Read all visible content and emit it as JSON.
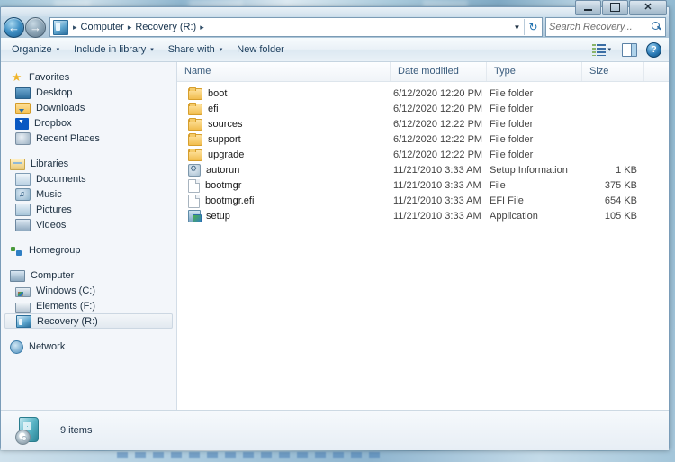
{
  "window": {
    "controls": {
      "minimize_label": "Minimize",
      "maximize_label": "Maximize",
      "close_label": "Close"
    }
  },
  "address_bar": {
    "back_label": "←",
    "forward_label": "→",
    "breadcrumbs": [
      "Computer",
      "Recovery (R:)"
    ],
    "separator": "▸",
    "dropdown_label": "▼",
    "refresh_label": "↻",
    "drive_icon": "recovery-drive-icon"
  },
  "search": {
    "placeholder": "Search Recovery...",
    "value": "Search Recovery...",
    "icon": "search-icon"
  },
  "toolbar": {
    "items": [
      {
        "label": "Organize",
        "has_caret": true
      },
      {
        "label": "Include in library",
        "has_caret": true
      },
      {
        "label": "Share with",
        "has_caret": true
      },
      {
        "label": "New folder",
        "has_caret": false
      }
    ],
    "caret": "▾",
    "views_icon": "view-options-icon",
    "preview_icon": "preview-pane-icon",
    "help_icon": "help-icon",
    "help_glyph": "?"
  },
  "sidebar": {
    "groups": [
      {
        "root": {
          "label": "Favorites",
          "icon": "star-icon"
        },
        "items": [
          {
            "label": "Desktop",
            "icon": "desktop-icon"
          },
          {
            "label": "Downloads",
            "icon": "downloads-folder-icon"
          },
          {
            "label": "Dropbox",
            "icon": "dropbox-icon"
          },
          {
            "label": "Recent Places",
            "icon": "recent-places-icon"
          }
        ]
      },
      {
        "root": {
          "label": "Libraries",
          "icon": "libraries-icon"
        },
        "items": [
          {
            "label": "Documents",
            "icon": "documents-icon"
          },
          {
            "label": "Music",
            "icon": "music-icon"
          },
          {
            "label": "Pictures",
            "icon": "pictures-icon"
          },
          {
            "label": "Videos",
            "icon": "videos-icon"
          }
        ]
      },
      {
        "root": {
          "label": "Homegroup",
          "icon": "homegroup-icon"
        },
        "items": []
      },
      {
        "root": {
          "label": "Computer",
          "icon": "computer-icon"
        },
        "items": [
          {
            "label": "Windows (C:)",
            "icon": "windows-drive-icon",
            "selected": false
          },
          {
            "label": "Elements (F:)",
            "icon": "usb-drive-icon",
            "selected": false
          },
          {
            "label": "Recovery (R:)",
            "icon": "recovery-drive-icon",
            "selected": true
          }
        ]
      },
      {
        "root": {
          "label": "Network",
          "icon": "network-icon"
        },
        "items": []
      }
    ]
  },
  "file_list": {
    "columns": [
      {
        "key": "name",
        "label": "Name"
      },
      {
        "key": "date",
        "label": "Date modified"
      },
      {
        "key": "type",
        "label": "Type"
      },
      {
        "key": "size",
        "label": "Size"
      }
    ],
    "rows": [
      {
        "name": "boot",
        "date": "6/12/2020 12:20 PM",
        "type": "File folder",
        "size": "",
        "icon": "folder-icon"
      },
      {
        "name": "efi",
        "date": "6/12/2020 12:20 PM",
        "type": "File folder",
        "size": "",
        "icon": "folder-icon"
      },
      {
        "name": "sources",
        "date": "6/12/2020 12:22 PM",
        "type": "File folder",
        "size": "",
        "icon": "folder-icon"
      },
      {
        "name": "support",
        "date": "6/12/2020 12:22 PM",
        "type": "File folder",
        "size": "",
        "icon": "folder-icon"
      },
      {
        "name": "upgrade",
        "date": "6/12/2020 12:22 PM",
        "type": "File folder",
        "size": "",
        "icon": "folder-icon"
      },
      {
        "name": "autorun",
        "date": "11/21/2010 3:33 AM",
        "type": "Setup Information",
        "size": "1 KB",
        "icon": "setup-information-icon"
      },
      {
        "name": "bootmgr",
        "date": "11/21/2010 3:33 AM",
        "type": "File",
        "size": "375 KB",
        "icon": "generic-file-icon"
      },
      {
        "name": "bootmgr.efi",
        "date": "11/21/2010 3:33 AM",
        "type": "EFI File",
        "size": "654 KB",
        "icon": "generic-file-icon"
      },
      {
        "name": "setup",
        "date": "11/21/2010 3:33 AM",
        "type": "Application",
        "size": "105 KB",
        "icon": "application-icon"
      }
    ]
  },
  "status_bar": {
    "item_count_text": "9 items",
    "icon": "recovery-drive-large-icon"
  },
  "colors": {
    "accent_blue": "#2b7cb8",
    "folder_yellow": "#f1bd4e",
    "selection": "#e2e9f0",
    "window_border": "#7a9cb8"
  }
}
